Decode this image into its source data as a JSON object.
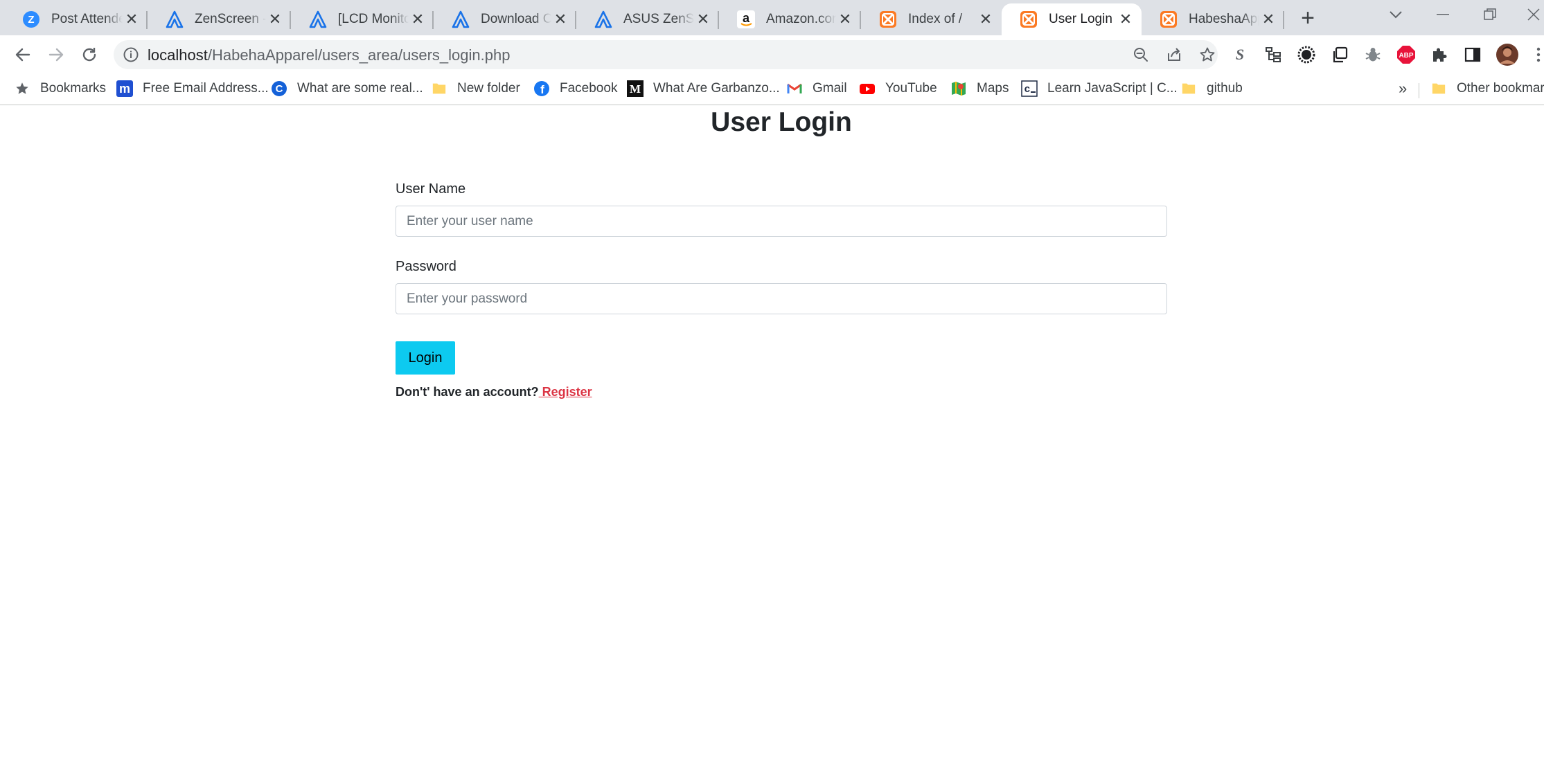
{
  "browser": {
    "tabs": [
      {
        "title": "Post Attendee",
        "icon": "zoom-icon"
      },
      {
        "title": "ZenScreen - A",
        "icon": "asus-icon"
      },
      {
        "title": "[LCD Monitor",
        "icon": "asus-icon"
      },
      {
        "title": "Download Ce",
        "icon": "asus-icon"
      },
      {
        "title": "ASUS ZenScre",
        "icon": "asus-icon"
      },
      {
        "title": "Amazon.com",
        "icon": "amazon-icon"
      },
      {
        "title": "Index of /",
        "icon": "xampp-icon"
      },
      {
        "title": "User Login",
        "icon": "xampp-icon",
        "active": true
      },
      {
        "title": "HabeshaAppa",
        "icon": "xampp-icon"
      }
    ],
    "address": {
      "host": "localhost",
      "path": "/HabehaApparel/users_area/users_login.php"
    },
    "bookmarks": [
      {
        "label": "Bookmarks",
        "icon": "star-icon"
      },
      {
        "label": "Free Email Address...",
        "icon": "mail-logo-icon"
      },
      {
        "label": "What are some real...",
        "icon": "c-logo-icon"
      },
      {
        "label": "New folder",
        "icon": "folder-icon"
      },
      {
        "label": "Facebook",
        "icon": "facebook-icon"
      },
      {
        "label": "What Are Garbanzo...",
        "icon": "medium-icon"
      },
      {
        "label": "Gmail",
        "icon": "gmail-icon"
      },
      {
        "label": "YouTube",
        "icon": "youtube-icon"
      },
      {
        "label": "Maps",
        "icon": "maps-icon"
      },
      {
        "label": "Learn JavaScript | C...",
        "icon": "codecademy-icon"
      },
      {
        "label": "github",
        "icon": "folder-icon"
      }
    ],
    "overflow_label": "»",
    "other_bookmarks": "Other bookmarks",
    "colors": {
      "tabstrip": "#dee1e6",
      "omnibox": "#f1f3f4"
    }
  },
  "page": {
    "title": "User Login",
    "username_label": "User Name",
    "username_placeholder": "Enter your user name",
    "username_value": "",
    "password_label": "Password",
    "password_placeholder": "Enter your password",
    "password_value": "",
    "login_button": "Login",
    "register_prompt": "Don't' have an account?",
    "register_link": " Register",
    "colors": {
      "button": "#0dcaf0",
      "link": "#dc3545"
    }
  }
}
